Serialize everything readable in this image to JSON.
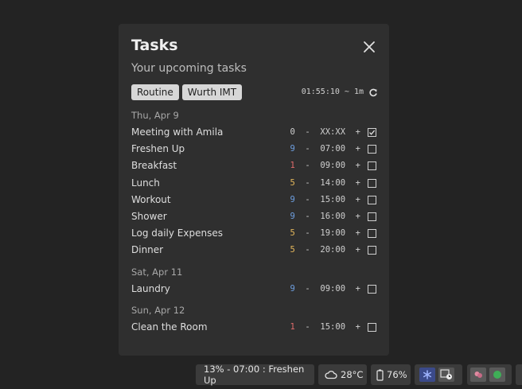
{
  "panel": {
    "title": "Tasks",
    "subtitle": "Your upcoming tasks",
    "tags": [
      "Routine",
      "Wurth IMT"
    ],
    "timer": "01:55:10 ~ 1m"
  },
  "days": [
    {
      "label": "Thu, Apr 9",
      "tasks": [
        {
          "name": "Meeting with Amila",
          "priority": "0",
          "time": "XX:XX",
          "checked": true
        },
        {
          "name": "Freshen Up",
          "priority": "9",
          "time": "07:00",
          "checked": false
        },
        {
          "name": "Breakfast",
          "priority": "1",
          "time": "09:00",
          "checked": false
        },
        {
          "name": "Lunch",
          "priority": "5",
          "time": "14:00",
          "checked": false
        },
        {
          "name": "Workout",
          "priority": "9",
          "time": "15:00",
          "checked": false
        },
        {
          "name": "Shower",
          "priority": "9",
          "time": "16:00",
          "checked": false
        },
        {
          "name": "Log daily Expenses",
          "priority": "5",
          "time": "19:00",
          "checked": false
        },
        {
          "name": "Dinner",
          "priority": "5",
          "time": "20:00",
          "checked": false
        }
      ]
    },
    {
      "label": "Sat, Apr 11",
      "tasks": [
        {
          "name": "Laundry",
          "priority": "9",
          "time": "09:00",
          "checked": false
        }
      ]
    },
    {
      "label": "Sun, Apr 12",
      "tasks": [
        {
          "name": "Clean the Room",
          "priority": "1",
          "time": "15:00",
          "checked": false
        }
      ]
    }
  ],
  "priority_colors": {
    "0": "#cfcfcf",
    "1": "#e06c6c",
    "5": "#e5b85c",
    "9": "#6e9fe0"
  },
  "taskbar": {
    "current_task": "13% - 07:00 : Freshen Up",
    "weather": "28°C",
    "battery": "76%"
  },
  "colors": {
    "background": "#232323",
    "panel": "#2f2f2f",
    "tag": "#d7d7d7"
  }
}
